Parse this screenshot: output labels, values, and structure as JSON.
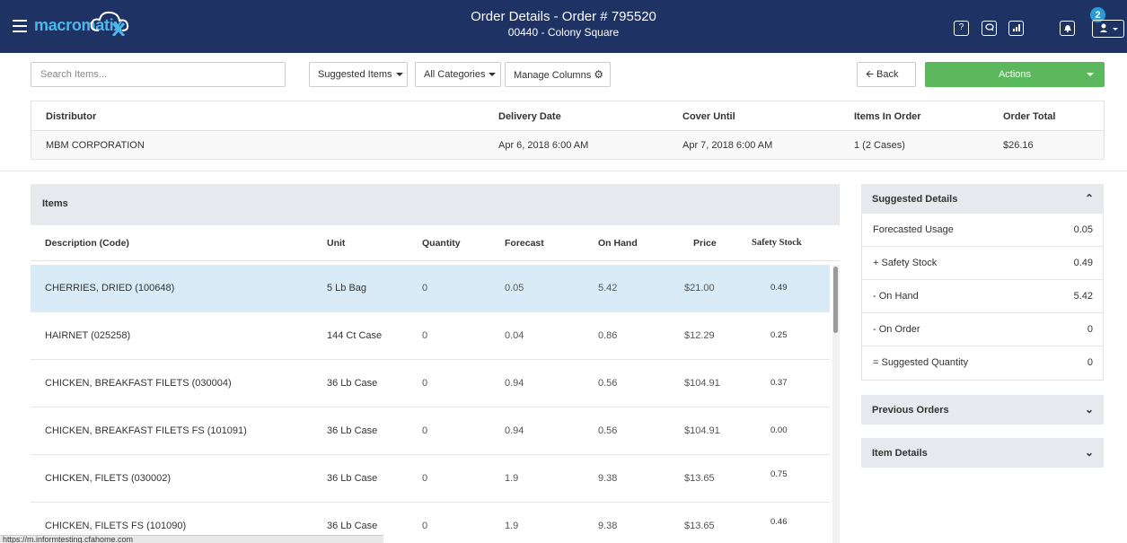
{
  "header": {
    "logo": "macromatix",
    "title": "Order Details - Order # 795520",
    "subtitle": "00440 - Colony Square",
    "notification_count": "2",
    "help_label": "?"
  },
  "toolbar": {
    "search_placeholder": "Search Items...",
    "suggested_items": "Suggested Items",
    "all_categories": "All Categories",
    "manage_columns": "Manage Columns",
    "back": "Back",
    "actions": "Actions"
  },
  "summary": {
    "headers": {
      "distributor": "Distributor",
      "delivery_date": "Delivery Date",
      "cover_until": "Cover Until",
      "items_in_order": "Items In Order",
      "order_total": "Order Total"
    },
    "values": {
      "distributor": "MBM CORPORATION",
      "delivery_date": "Apr 6, 2018 6:00 AM",
      "cover_until": "Apr 7, 2018 6:00 AM",
      "items_in_order": "1 (2 Cases)",
      "order_total": "$26.16"
    }
  },
  "items": {
    "title": "Items",
    "columns": {
      "description": "Description (Code)",
      "unit": "Unit",
      "quantity": "Quantity",
      "forecast": "Forecast",
      "on_hand": "On Hand",
      "price": "Price",
      "safety_stock": "Safety Stock"
    },
    "rows": [
      {
        "description": "CHERRIES, DRIED (100648)",
        "unit": "5 Lb Bag",
        "quantity": "0",
        "forecast": "0.05",
        "on_hand": "5.42",
        "price": "$21.00",
        "safety_stock": "0.49"
      },
      {
        "description": "HAIRNET (025258)",
        "unit": "144 Ct Case",
        "quantity": "0",
        "forecast": "0.04",
        "on_hand": "0.86",
        "price": "$12.29",
        "safety_stock": "0.25"
      },
      {
        "description": "CHICKEN, BREAKFAST FILETS (030004)",
        "unit": "36 Lb Case",
        "quantity": "0",
        "forecast": "0.94",
        "on_hand": "0.56",
        "price": "$104.91",
        "safety_stock": "0.37"
      },
      {
        "description": "CHICKEN, BREAKFAST FILETS FS (101091)",
        "unit": "36 Lb Case",
        "quantity": "0",
        "forecast": "0.94",
        "on_hand": "0.56",
        "price": "$104.91",
        "safety_stock": "0.00"
      },
      {
        "description": "CHICKEN, FILETS (030002)",
        "unit": "36 Lb Case",
        "quantity": "0",
        "forecast": "1.9",
        "on_hand": "9.38",
        "price": "$13.65",
        "safety_stock": "0.75"
      },
      {
        "description": "CHICKEN, FILETS FS (101090)",
        "unit": "36 Lb Case",
        "quantity": "0",
        "forecast": "1.9",
        "on_hand": "9.38",
        "price": "$13.65",
        "safety_stock": "0.46"
      }
    ]
  },
  "suggested_details": {
    "title": "Suggested Details",
    "rows": [
      {
        "label": "Forecasted Usage",
        "value": "0.05"
      },
      {
        "label": "+ Safety Stock",
        "value": "0.49"
      },
      {
        "label": "- On Hand",
        "value": "5.42"
      },
      {
        "label": "- On Order",
        "value": "0"
      },
      {
        "label": "= Suggested Quantity",
        "value": "0"
      }
    ]
  },
  "previous_orders": {
    "title": "Previous Orders"
  },
  "item_details": {
    "title": "Item Details"
  },
  "status_bar": {
    "url": "https://m.informtesting.cfahome.com"
  },
  "colors": {
    "header_bg": "#1f3264",
    "actions_green": "#5cb85c",
    "selected_row": "#d9ebf6",
    "panel_head": "#e8e9ee"
  }
}
